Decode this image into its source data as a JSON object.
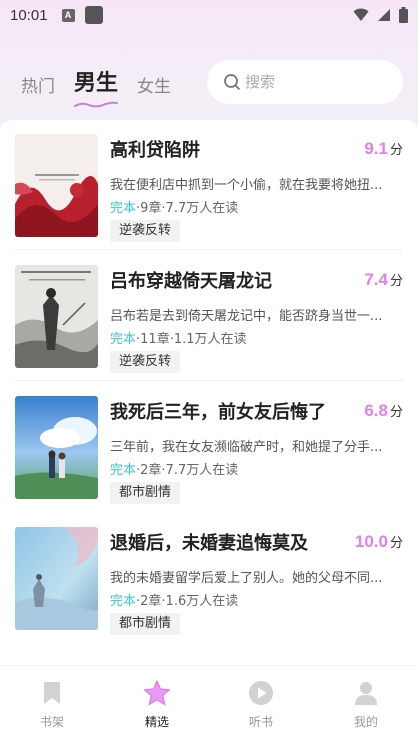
{
  "status_bar": {
    "time": "10:01",
    "notif_letter": "A"
  },
  "top_nav": {
    "tabs": [
      {
        "label": "热门"
      },
      {
        "label": "男生"
      },
      {
        "label": "女生"
      }
    ],
    "search": {
      "placeholder": "搜索"
    }
  },
  "colors": {
    "accent": "#e17ff0",
    "status_done": "#3ac8d0"
  },
  "books": [
    {
      "title": "高利贷陷阱",
      "score": "9.1",
      "score_unit": "分",
      "desc": "我在便利店中抓到一个小偷，就在我要将她扭...",
      "status": "完本",
      "meta": "·9章·7.7万人在读",
      "tag": "逆袭反转",
      "cover_text": "我陷入了高利贷陷阱"
    },
    {
      "title": "吕布穿越倚天屠龙记",
      "score": "7.4",
      "score_unit": "分",
      "desc": "吕布若是去到倚天屠龙记中，能否跻身当世一...",
      "status": "完本",
      "meta": "·11章·1.1万人在读",
      "tag": "逆袭反转",
      "cover_text": "吕布穿越倚天屠龙记"
    },
    {
      "title": "我死后三年，前女友后悔了",
      "score": "6.8",
      "score_unit": "分",
      "desc": "三年前，我在女友濒临破产时，和她提了分手...",
      "status": "完本",
      "meta": "·2章·7.7万人在读",
      "tag": "都市剧情",
      "cover_text": ""
    },
    {
      "title": "退婚后，未婚妻追悔莫及",
      "score": "10.0",
      "score_unit": "分",
      "desc": "我的未婚妻留学后爱上了别人。她的父母不同...",
      "status": "完本",
      "meta": "·2章·1.6万人在读",
      "tag": "都市剧情",
      "cover_text": ""
    }
  ],
  "bottom_nav": {
    "items": [
      {
        "label": "书架",
        "icon": "bookmark-icon"
      },
      {
        "label": "精选",
        "icon": "star-icon"
      },
      {
        "label": "听书",
        "icon": "play-icon"
      },
      {
        "label": "我的",
        "icon": "user-icon"
      }
    ]
  }
}
